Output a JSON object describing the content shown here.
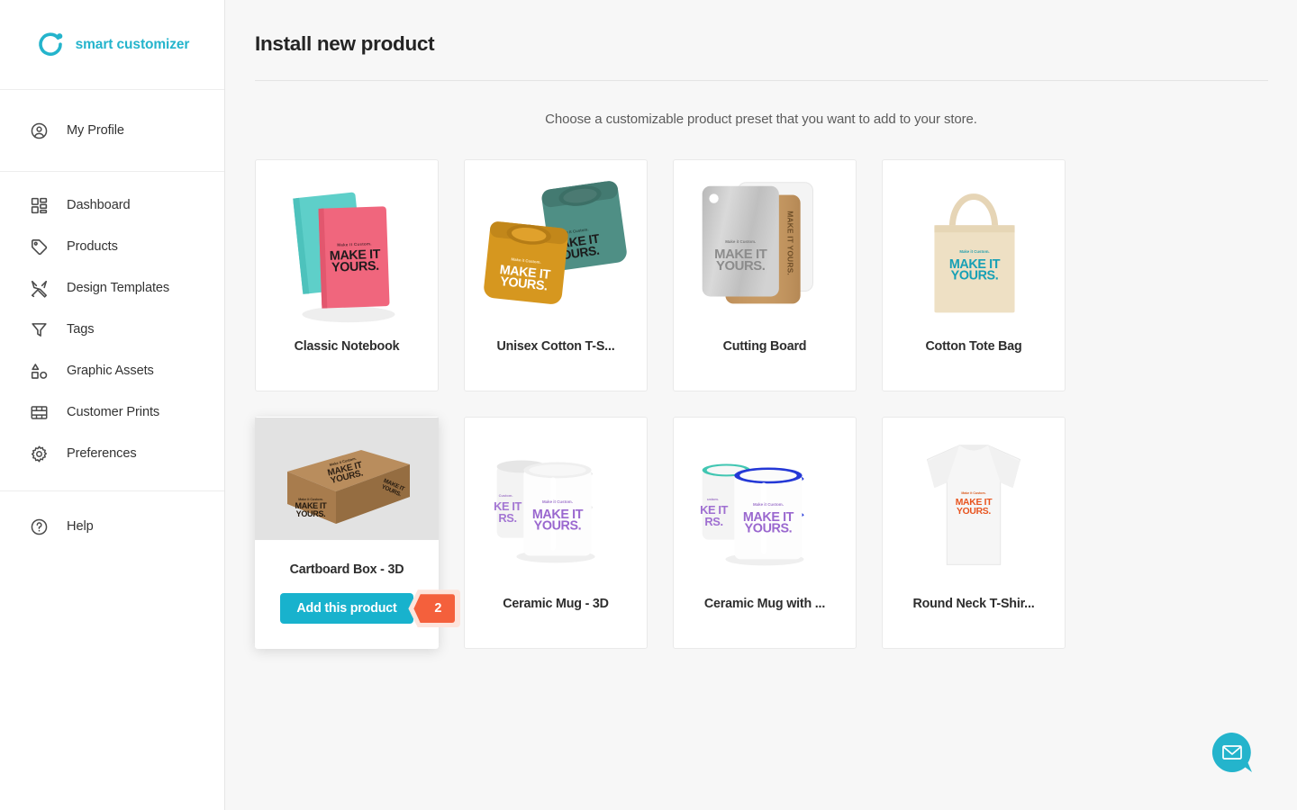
{
  "brand": {
    "name": "smart customizer",
    "logo_icon": "circle-dot-logo-icon",
    "accent_color": "#24b4cc"
  },
  "sidebar": {
    "profile": [
      {
        "label": "My Profile",
        "icon": "user-circle-icon"
      }
    ],
    "items": [
      {
        "label": "Dashboard",
        "icon": "dashboard-grid-icon"
      },
      {
        "label": "Products",
        "icon": "tag-icon"
      },
      {
        "label": "Design Templates",
        "icon": "pencil-ruler-icon"
      },
      {
        "label": "Tags",
        "icon": "funnel-icon"
      },
      {
        "label": "Graphic Assets",
        "icon": "shapes-icon"
      },
      {
        "label": "Customer Prints",
        "icon": "layout-grid-icon"
      },
      {
        "label": "Preferences",
        "icon": "gear-icon"
      }
    ],
    "help": [
      {
        "label": "Help",
        "icon": "question-circle-icon"
      }
    ]
  },
  "header": {
    "title": "Install new product"
  },
  "main": {
    "subtitle": "Choose a customizable product preset that you want to add to your store.",
    "products": [
      {
        "name": "Classic Notebook",
        "art": "notebook",
        "print_text": "MAKE IT YOURS."
      },
      {
        "name": "Unisex Cotton T-S...",
        "art": "tshirts",
        "print_text": "MAKE IT YOURS."
      },
      {
        "name": "Cutting Board",
        "art": "cuttingboard",
        "print_text": "MAKE IT YOURS."
      },
      {
        "name": "Cotton Tote Bag",
        "art": "tote",
        "print_text": "MAKE IT YOURS."
      },
      {
        "name": "Cartboard Box - 3D",
        "art": "box",
        "print_text": "MAKE IT YOURS."
      },
      {
        "name": "Ceramic Mug - 3D",
        "art": "mugs",
        "print_text": "MAKE IT YOURS."
      },
      {
        "name": "Ceramic Mug with ...",
        "art": "mugscolor",
        "print_text": "MAKE IT YOURS."
      },
      {
        "name": "Round Neck T-Shir...",
        "art": "whitetee",
        "print_text": "MAKE IT YOURS."
      }
    ],
    "active_card": {
      "name": "Cartboard Box - 3D",
      "add_button_label": "Add this product",
      "step_badge": "2",
      "button_color": "#18b2cd",
      "badge_color": "#f4603c"
    }
  },
  "chat": {
    "icon": "envelope-chat-icon",
    "color": "#24b4cc"
  }
}
